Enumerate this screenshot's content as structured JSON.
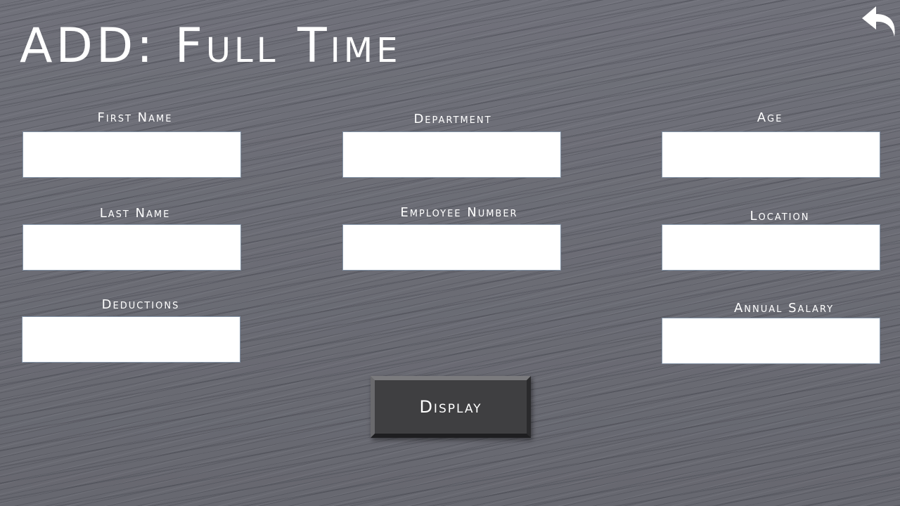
{
  "page": {
    "title": "ADD: Full Time"
  },
  "header": {
    "back_icon": "undo-arrow-icon"
  },
  "form": {
    "fields": {
      "first_name": {
        "label": "First Name",
        "value": ""
      },
      "department": {
        "label": "Department",
        "value": ""
      },
      "age": {
        "label": "Age",
        "value": ""
      },
      "last_name": {
        "label": "Last Name",
        "value": ""
      },
      "employee_number": {
        "label": "Employee Number",
        "value": ""
      },
      "location": {
        "label": "Location",
        "value": ""
      },
      "deductions": {
        "label": "Deductions",
        "value": ""
      },
      "annual_salary": {
        "label": "Annual Salary",
        "value": ""
      }
    },
    "display_button_label": "Display"
  },
  "colors": {
    "background": "#6b6c73",
    "button_face": "#3f3f41",
    "text": "#ffffff",
    "field_border": "#8393a6"
  }
}
